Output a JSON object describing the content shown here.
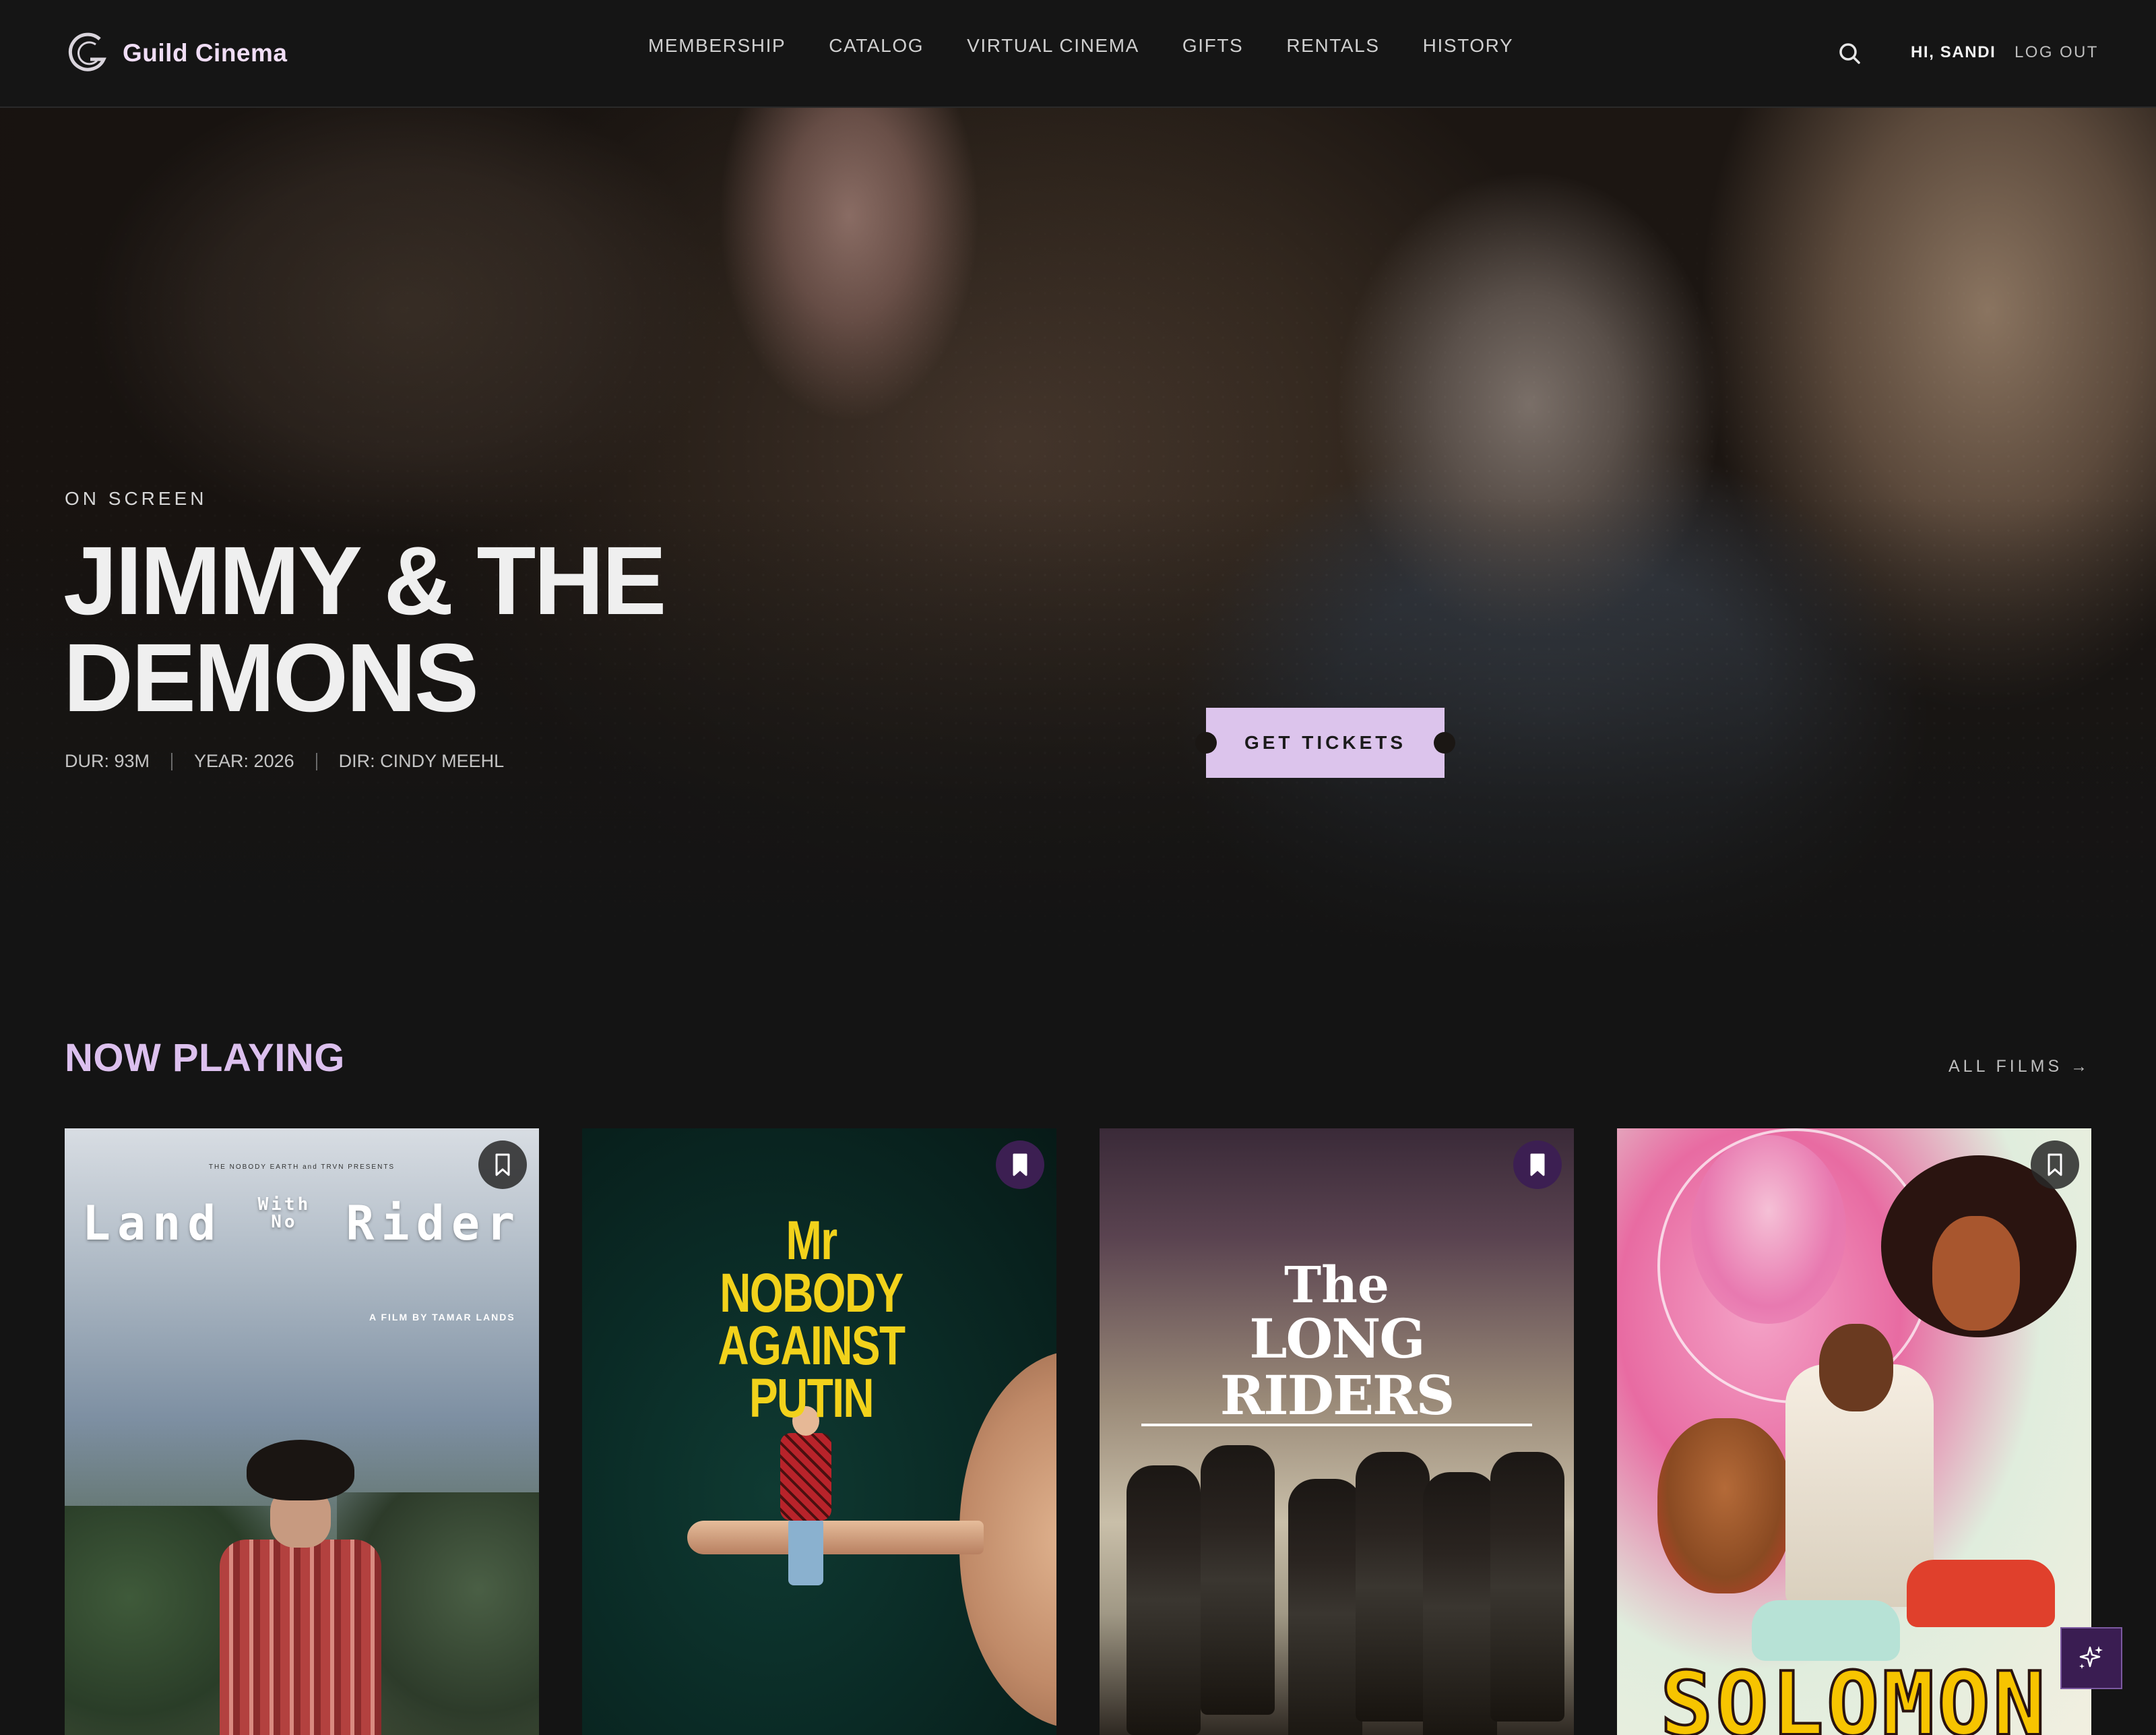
{
  "header": {
    "brand_name": "Guild Cinema",
    "brand_icon": "guild-cinema-logo",
    "nav": [
      "MEMBERSHIP",
      "CATALOG",
      "VIRTUAL CINEMA",
      "GIFTS",
      "RENTALS",
      "HISTORY"
    ],
    "search_icon": "search-icon",
    "greeting": "HI, SANDI",
    "logout": "LOG OUT"
  },
  "hero": {
    "eyebrow": "ON SCREEN",
    "title": "JIMMY & THE DEMONS",
    "duration": "DUR: 93M",
    "year": "YEAR: 2026",
    "director": "DIR: CINDY MEEHL",
    "cta": "GET TICKETS"
  },
  "now_playing": {
    "title": "NOW PLAYING",
    "all_films": "ALL FILMS →",
    "films": [
      {
        "poster_title": "Land With No Rider",
        "poster_title_parts": [
          "Land",
          "With",
          "No",
          "Rider"
        ],
        "poster_credit_top": "THE NOBODY EARTH and TRVN PRESENTS",
        "poster_credit": "A FILM BY TAMAR LANDS",
        "bookmarked": false
      },
      {
        "poster_title": "Mr NOBODY AGAINST PUTIN",
        "poster_title_lines": [
          "Mr NOBODY",
          "AGAINST",
          "PUTIN"
        ],
        "bookmarked": true
      },
      {
        "poster_title": "The LONG RIDERS",
        "poster_title_lines": [
          "The",
          "LONG RIDERS"
        ],
        "bookmarked": true
      },
      {
        "poster_title": "SOLOMON",
        "bookmarked": false
      }
    ]
  },
  "fab_icon": "sparkle-icon",
  "colors": {
    "accent": "#dcc4ec",
    "section_title": "#dcc0ee",
    "background": "#141414",
    "bookmark_active": "#3c1f52"
  }
}
